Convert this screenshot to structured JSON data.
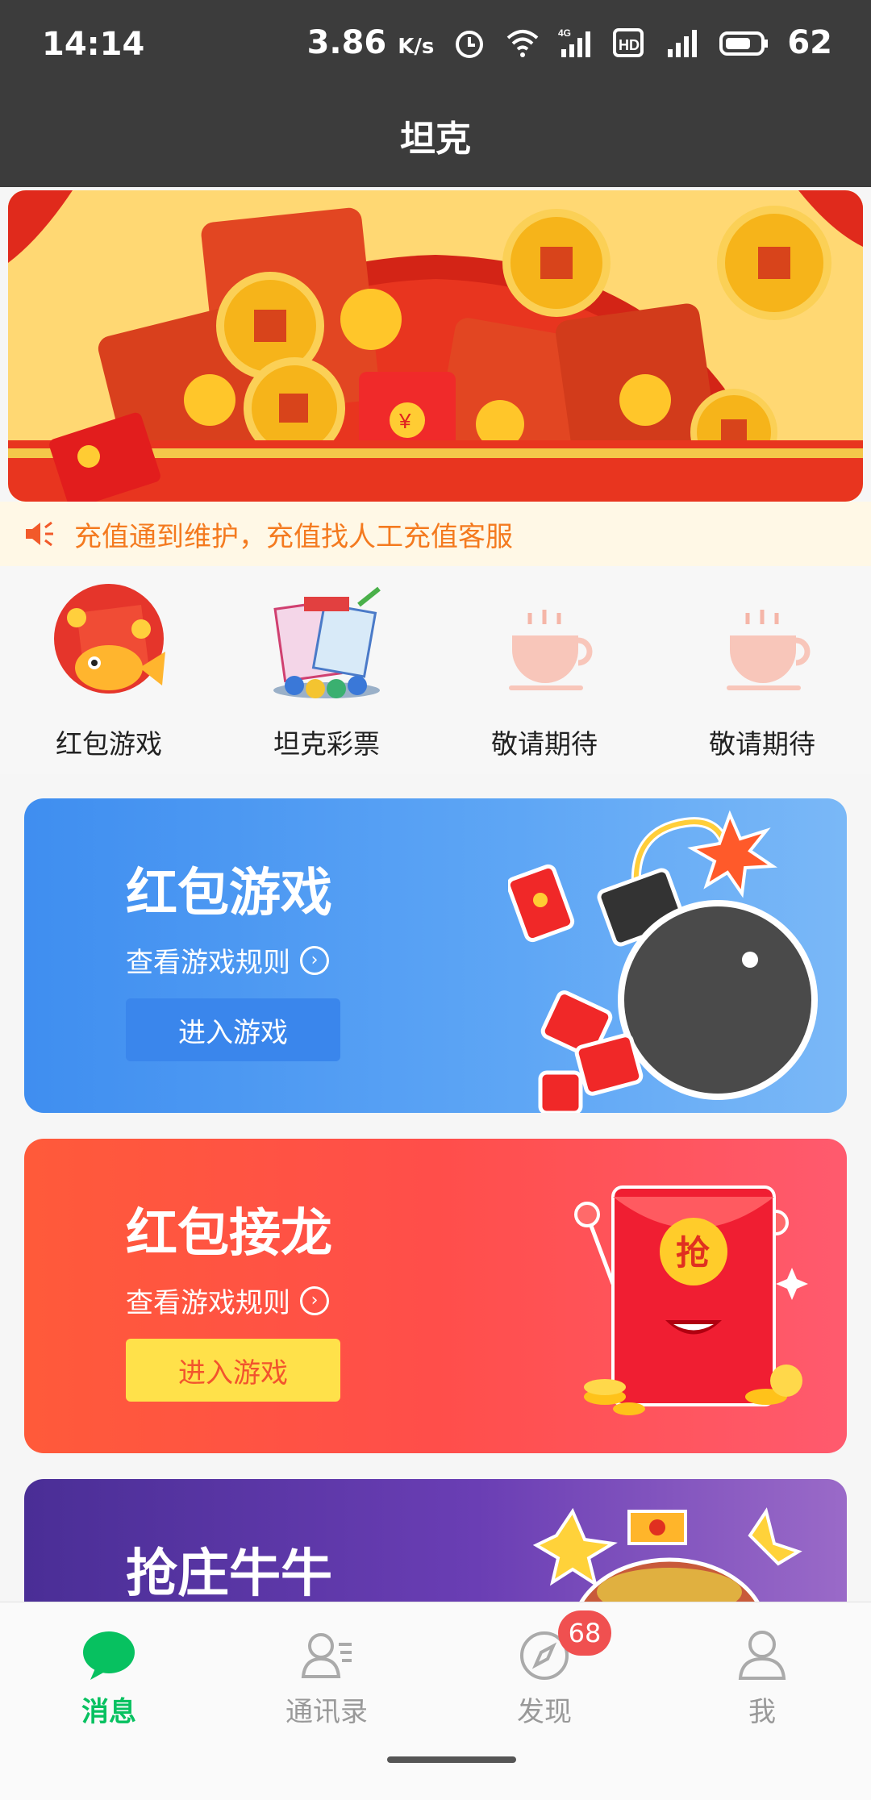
{
  "status_bar": {
    "time": "14:14",
    "net_speed": "3.86",
    "net_speed_unit": "K/s",
    "battery": "62"
  },
  "header": {
    "title": "坦克"
  },
  "notice": {
    "text": "充值通到维护，充值找人工充值客服"
  },
  "quick_menu": [
    {
      "label": "红包游戏",
      "icon": "red-packet-fish-icon"
    },
    {
      "label": "坦克彩票",
      "icon": "bingo-lottery-icon"
    },
    {
      "label": "敬请期待",
      "icon": "coffee-cup-icon"
    },
    {
      "label": "敬请期待",
      "icon": "coffee-cup-icon"
    }
  ],
  "cards": [
    {
      "title": "红包游戏",
      "rules_link": "查看游戏规则",
      "button": "进入游戏",
      "accent": "#3f8ef0"
    },
    {
      "title": "红包接龙",
      "rules_link": "查看游戏规则",
      "button": "进入游戏",
      "accent": "#ff4e4a"
    },
    {
      "title": "抢庄牛牛",
      "accent": "#6a3eb4"
    }
  ],
  "red_packet_char": "抢",
  "tabs": [
    {
      "label": "消息",
      "icon": "chat-bubble-icon",
      "active": true
    },
    {
      "label": "通讯录",
      "icon": "contacts-icon",
      "active": false
    },
    {
      "label": "发现",
      "icon": "compass-icon",
      "active": false,
      "badge": "68"
    },
    {
      "label": "我",
      "icon": "person-icon",
      "active": false
    }
  ],
  "colors": {
    "active_tab": "#07c160",
    "notice_text": "#f47a1f",
    "badge": "#f05050"
  }
}
